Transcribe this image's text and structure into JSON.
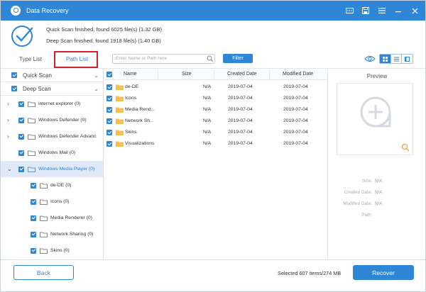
{
  "window": {
    "title": "Data Recovery",
    "controls": [
      "feedback-icon",
      "save-icon",
      "menu-icon",
      "minimize-icon",
      "close-icon"
    ]
  },
  "summary": {
    "quick_scan": "Quick Scan finished, found 6025 file(s) (1.32 GB)",
    "deep_scan": "Deep Scan finished, found 1918 file(s) (1.40 GB)"
  },
  "tabs": {
    "type_list": "Type List",
    "path_list": "Path List",
    "active": "Path List"
  },
  "search": {
    "placeholder": "Enter Name or Path here"
  },
  "filter_label": "Filter",
  "scan_sections": [
    {
      "label": "Quick Scan",
      "checked": true
    },
    {
      "label": "Deep Scan",
      "checked": false
    }
  ],
  "tree": [
    {
      "label": "internet explorer (0)",
      "expandable": true
    },
    {
      "label": "Windows Defender (0)",
      "expandable": true
    },
    {
      "label": "Windows Defender Advanc",
      "expandable": true
    },
    {
      "label": "Windows Mail (0)",
      "expandable": false
    },
    {
      "label": "Windows Media Player (0)",
      "expandable": true,
      "selected": true
    },
    {
      "label": "de-DE (0)",
      "child": true
    },
    {
      "label": "Icons (0)",
      "child": true
    },
    {
      "label": "Media Renderer (0)",
      "child": true
    },
    {
      "label": "Network Sharing (0)",
      "child": true
    },
    {
      "label": "Skins (0)",
      "child": true
    }
  ],
  "table": {
    "headers": {
      "name": "Name",
      "size": "Size",
      "created": "Created Date",
      "modified": "Modified Date"
    },
    "rows": [
      {
        "name": "de-DE",
        "size": "N/A",
        "created": "2019-07-04",
        "modified": "2019-07-04"
      },
      {
        "name": "Icons",
        "size": "N/A",
        "created": "2019-07-04",
        "modified": "2019-07-04"
      },
      {
        "name": "Media Rend...",
        "size": "N/A",
        "created": "2019-07-04",
        "modified": "2019-07-04"
      },
      {
        "name": "Network Sh...",
        "size": "N/A",
        "created": "2019-07-04",
        "modified": "2019-07-04"
      },
      {
        "name": "Skins",
        "size": "N/A",
        "created": "2019-07-04",
        "modified": "2019-07-04"
      },
      {
        "name": "Visualizations",
        "size": "N/A",
        "created": "2019-07-04",
        "modified": "2019-07-04"
      }
    ]
  },
  "preview": {
    "title": "Preview",
    "fields": [
      {
        "key": "Size:",
        "value": "N/A"
      },
      {
        "key": "Created Date:",
        "value": "N/A"
      },
      {
        "key": "Modified Date:",
        "value": "N/A"
      },
      {
        "key": "Path:",
        "value": ""
      }
    ]
  },
  "footer": {
    "back": "Back",
    "selected": "Selected 607 items/274 MB",
    "recover": "Recover"
  },
  "colors": {
    "accent": "#2f86d6",
    "highlight": "#d3222a",
    "folder": "#f2c14e"
  }
}
